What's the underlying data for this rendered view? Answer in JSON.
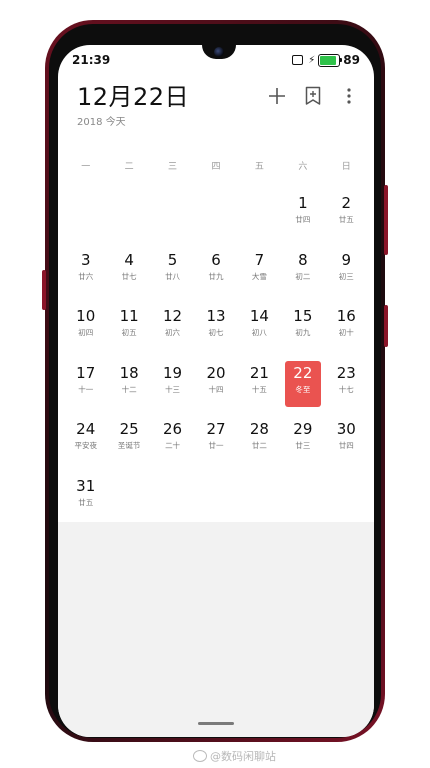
{
  "status": {
    "time": "21:39",
    "battery": "89",
    "battery_level": 0.89
  },
  "header": {
    "date_title": "12月22日",
    "year": "2018",
    "today_label": "今天"
  },
  "weekdays": [
    "一",
    "二",
    "三",
    "四",
    "五",
    "六",
    "日"
  ],
  "rows": [
    [
      {
        "d": "",
        "l": ""
      },
      {
        "d": "",
        "l": ""
      },
      {
        "d": "",
        "l": ""
      },
      {
        "d": "",
        "l": ""
      },
      {
        "d": "",
        "l": ""
      },
      {
        "d": "1",
        "l": "廿四"
      },
      {
        "d": "2",
        "l": "廿五"
      }
    ],
    [
      {
        "d": "3",
        "l": "廿六"
      },
      {
        "d": "4",
        "l": "廿七"
      },
      {
        "d": "5",
        "l": "廿八"
      },
      {
        "d": "6",
        "l": "廿九"
      },
      {
        "d": "7",
        "l": "大雪"
      },
      {
        "d": "8",
        "l": "初二"
      },
      {
        "d": "9",
        "l": "初三"
      }
    ],
    [
      {
        "d": "10",
        "l": "初四"
      },
      {
        "d": "11",
        "l": "初五"
      },
      {
        "d": "12",
        "l": "初六"
      },
      {
        "d": "13",
        "l": "初七"
      },
      {
        "d": "14",
        "l": "初八"
      },
      {
        "d": "15",
        "l": "初九"
      },
      {
        "d": "16",
        "l": "初十"
      }
    ],
    [
      {
        "d": "17",
        "l": "十一"
      },
      {
        "d": "18",
        "l": "十二"
      },
      {
        "d": "19",
        "l": "十三"
      },
      {
        "d": "20",
        "l": "十四"
      },
      {
        "d": "21",
        "l": "十五"
      },
      {
        "d": "22",
        "l": "冬至",
        "today": true
      },
      {
        "d": "23",
        "l": "十七"
      }
    ],
    [
      {
        "d": "24",
        "l": "平安夜"
      },
      {
        "d": "25",
        "l": "圣诞节"
      },
      {
        "d": "26",
        "l": "二十"
      },
      {
        "d": "27",
        "l": "廿一"
      },
      {
        "d": "28",
        "l": "廿二"
      },
      {
        "d": "29",
        "l": "廿三"
      },
      {
        "d": "30",
        "l": "廿四"
      }
    ],
    [
      {
        "d": "31",
        "l": "廿五"
      }
    ]
  ],
  "colors": {
    "accent": "#ea5350",
    "battery_green": "#2fc24a",
    "frame": "#7a1226"
  },
  "icons": {
    "add": "plus-icon",
    "bookmark": "bookmark-add-icon",
    "menu": "more-vertical-icon"
  },
  "watermark": {
    "text": "@数码闲聊站"
  }
}
